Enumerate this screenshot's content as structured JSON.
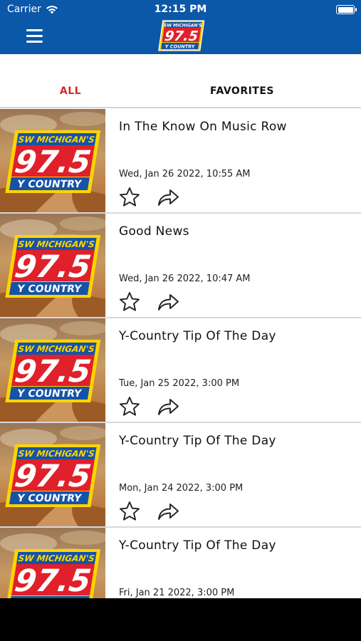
{
  "status_bar": {
    "carrier": "Carrier",
    "time": "12:15 PM"
  },
  "header": {
    "menu_icon": "hamburger-menu-icon",
    "logo": {
      "top_text": "SW MICHIGAN'S",
      "number": "97.5",
      "bottom_text": "Y COUNTRY"
    }
  },
  "tabs": [
    {
      "label": "ALL",
      "active": true,
      "color": "#d8262b"
    },
    {
      "label": "FAVORITES",
      "active": false,
      "color": "#111111"
    }
  ],
  "thumbnail": {
    "top_text": "SW MICHIGAN'S",
    "number": "97.5",
    "bottom_text": "Y COUNTRY"
  },
  "items": [
    {
      "title": "In The Know On Music Row",
      "date": "Wed, Jan 26 2022, 10:55 AM"
    },
    {
      "title": "Good News",
      "date": "Wed, Jan 26 2022, 10:47 AM"
    },
    {
      "title": "Y-Country Tip Of The Day",
      "date": "Tue, Jan 25 2022, 3:00 PM"
    },
    {
      "title": "Y-Country Tip Of The Day",
      "date": "Mon, Jan 24 2022, 3:00 PM"
    },
    {
      "title": "Y-Country Tip Of The Day",
      "date": "Fri, Jan 21 2022, 3:00 PM"
    }
  ],
  "icons": {
    "favorite": "star-outline-icon",
    "share": "share-arrow-icon"
  },
  "colors": {
    "header_bg": "#0b57a8",
    "active_tab": "#d8262b",
    "logo_red": "#e0202a",
    "logo_yellow": "#ffd400",
    "logo_blue": "#1553a8"
  }
}
